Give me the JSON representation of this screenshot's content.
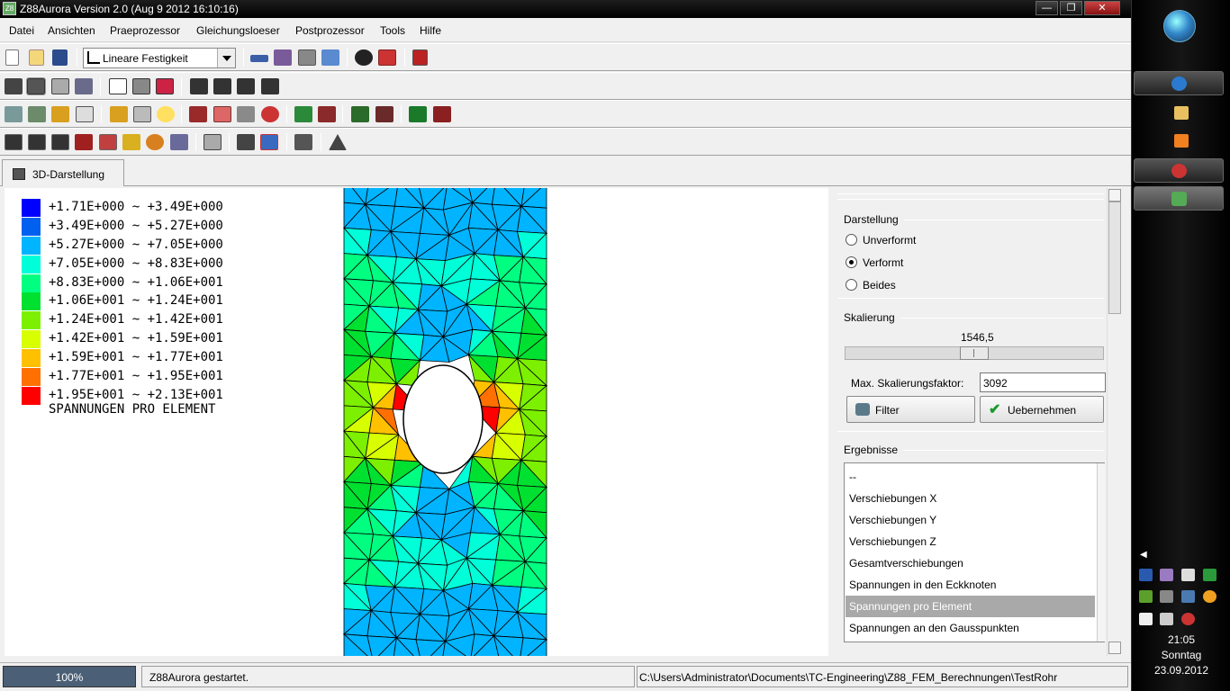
{
  "window": {
    "title": "Z88Aurora Version 2.0 (Aug  9 2012 16:10:16)",
    "controls": {
      "minimize": "—",
      "maximize": "❐",
      "close": "✕"
    }
  },
  "menubar": [
    "Datei",
    "Ansichten",
    "Praeprozessor",
    "Gleichungsloeser",
    "Postprozessor",
    "Tools",
    "Hilfe"
  ],
  "toolbar": {
    "analysis_type": "Lineare Festigkeit"
  },
  "tabs": [
    {
      "label": "3D-Darstellung"
    }
  ],
  "legend": {
    "rows": [
      {
        "text": "+1.71E+000 ~ +3.49E+000",
        "color": "#0000ff"
      },
      {
        "text": "+3.49E+000 ~ +5.27E+000",
        "color": "#0060f0"
      },
      {
        "text": "+5.27E+000 ~ +7.05E+000",
        "color": "#00b4ff"
      },
      {
        "text": "+7.05E+000 ~ +8.83E+000",
        "color": "#00ffd8"
      },
      {
        "text": "+8.83E+000 ~ +1.06E+001",
        "color": "#00ff80"
      },
      {
        "text": "+1.06E+001 ~ +1.24E+001",
        "color": "#00e030"
      },
      {
        "text": "+1.24E+001 ~ +1.42E+001",
        "color": "#7cf000"
      },
      {
        "text": "+1.42E+001 ~ +1.59E+001",
        "color": "#d8ff00"
      },
      {
        "text": "+1.59E+001 ~ +1.77E+001",
        "color": "#ffc000"
      },
      {
        "text": "+1.77E+001 ~ +1.95E+001",
        "color": "#ff7000"
      },
      {
        "text": "+1.95E+001 ~ +2.13E+001",
        "color": "#ff0000"
      }
    ],
    "caption": "SPANNUNGEN PRO ELEMENT"
  },
  "panel": {
    "darstellung": {
      "title": "Darstellung",
      "options": [
        {
          "label": "Unverformt",
          "checked": false
        },
        {
          "label": "Verformt",
          "checked": true
        },
        {
          "label": "Beides",
          "checked": false
        }
      ]
    },
    "skalierung": {
      "title": "Skalierung",
      "value": "1546,5",
      "slider_fraction": 0.5,
      "max_label": "Max. Skalierungsfaktor:",
      "max_value": "3092",
      "filter_label": "Filter",
      "apply_label": "Uebernehmen"
    },
    "ergebnisse": {
      "title": "Ergebnisse",
      "items": [
        {
          "label": "--",
          "selected": false
        },
        {
          "label": "Verschiebungen X",
          "selected": false
        },
        {
          "label": "Verschiebungen Y",
          "selected": false
        },
        {
          "label": "Verschiebungen Z",
          "selected": false
        },
        {
          "label": "Gesamtverschiebungen",
          "selected": false
        },
        {
          "label": "Spannungen in den Eckknoten",
          "selected": false
        },
        {
          "label": "Spannungen pro Element",
          "selected": true
        },
        {
          "label": "Spannungen an den Gausspunkten",
          "selected": false
        }
      ]
    }
  },
  "statusbar": {
    "progress": "100%",
    "progress_fraction": 1.0,
    "message": "Z88Aurora gestartet.",
    "path": "C:\\Users\\Administrator\\Documents\\TC-Engineering\\Z88_FEM_Berechnungen\\TestRohr"
  },
  "taskbar": {
    "time": "21:05",
    "day": "Sonntag",
    "date": "23.09.2012"
  }
}
